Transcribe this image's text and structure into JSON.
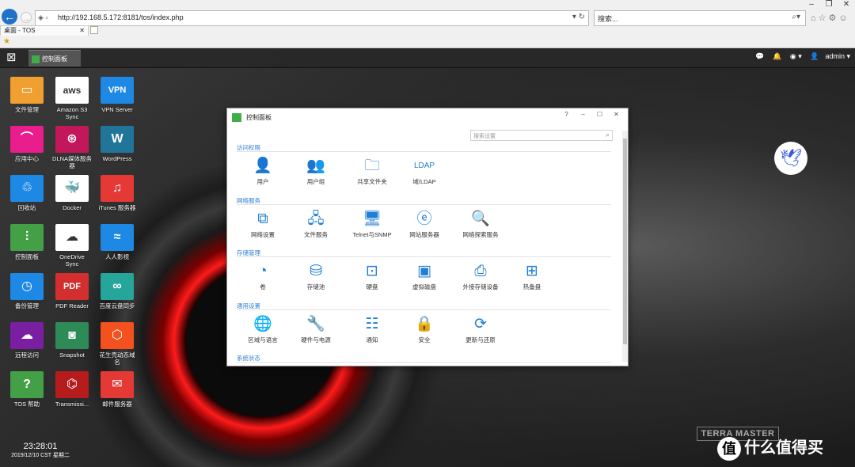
{
  "browser": {
    "url": "http://192.168.5.172:8181/tos/index.php",
    "search_placeholder": "搜索...",
    "tab_title": "桌面 - TOS"
  },
  "taskbar": {
    "task_label": "控制面板",
    "user": "admin"
  },
  "desktop": {
    "icons": [
      {
        "label": "文件管理",
        "color": "#f0a030",
        "glyph": "folder-icon"
      },
      {
        "label": "Amazon S3 Sync",
        "color": "#ffffff",
        "glyph": "aws-icon"
      },
      {
        "label": "VPN Server",
        "color": "#1e88e5",
        "glyph": "vpn-icon"
      },
      {
        "label": "应用中心",
        "color": "#e91e8c",
        "glyph": "bag-icon"
      },
      {
        "label": "DLNA媒体服务器",
        "color": "#c2185b",
        "glyph": "dlna-icon"
      },
      {
        "label": "WordPress",
        "color": "#21759b",
        "glyph": "wordpress-icon"
      },
      {
        "label": "回收站",
        "color": "#1e88e5",
        "glyph": "recycle-icon"
      },
      {
        "label": "Docker",
        "color": "#ffffff",
        "glyph": "docker-icon"
      },
      {
        "label": "iTunes 服务器",
        "color": "#e53935",
        "glyph": "music-icon"
      },
      {
        "label": "控制面板",
        "color": "#43a047",
        "glyph": "sliders-icon"
      },
      {
        "label": "OneDrive Sync",
        "color": "#ffffff",
        "glyph": "cloud-icon"
      },
      {
        "label": "人人影视",
        "color": "#1e88e5",
        "glyph": "wave-icon"
      },
      {
        "label": "备份管理",
        "color": "#1e88e5",
        "glyph": "clock-icon"
      },
      {
        "label": "PDF Reader",
        "color": "#d32f2f",
        "glyph": "pdf-icon"
      },
      {
        "label": "百度云盘同步",
        "color": "#26a69a",
        "glyph": "baidu-icon"
      },
      {
        "label": "远程访问",
        "color": "#7b1fa2",
        "glyph": "cloud-icon"
      },
      {
        "label": "Snapshot",
        "color": "#2e8b57",
        "glyph": "camera-icon"
      },
      {
        "label": "花生壳动态域名",
        "color": "#f4511e",
        "glyph": "box-icon"
      },
      {
        "label": "TOS 帮助",
        "color": "#43a047",
        "glyph": "help-icon"
      },
      {
        "label": "Transmissi...",
        "color": "#b71c1c",
        "glyph": "transmission-icon"
      },
      {
        "label": "邮件服务器",
        "color": "#e53935",
        "glyph": "mail-icon"
      }
    ],
    "clock_time": "23:28:01",
    "clock_date": "2019/12/10 CST 星期二",
    "brand": "TERRA MASTER",
    "watermark": "什么值得买"
  },
  "control_panel": {
    "title": "控制面板",
    "search_placeholder": "搜索设置",
    "sections": [
      {
        "title": "访问权限",
        "items": [
          "用户",
          "用户组",
          "共享文件夹",
          "域/LDAP"
        ]
      },
      {
        "title": "网络服务",
        "items": [
          "网络设置",
          "文件服务",
          "Telnet与SNMP",
          "网站服务器",
          "网络探索服务"
        ]
      },
      {
        "title": "存储管理",
        "items": [
          "卷",
          "存储池",
          "硬盘",
          "虚拟磁盘",
          "外接存储设备",
          "热备盘"
        ]
      },
      {
        "title": "通用设置",
        "items": [
          "区域与语言",
          "硬件与电源",
          "通知",
          "安全",
          "更新与还原"
        ]
      },
      {
        "title": "系统状态",
        "items": []
      }
    ]
  }
}
